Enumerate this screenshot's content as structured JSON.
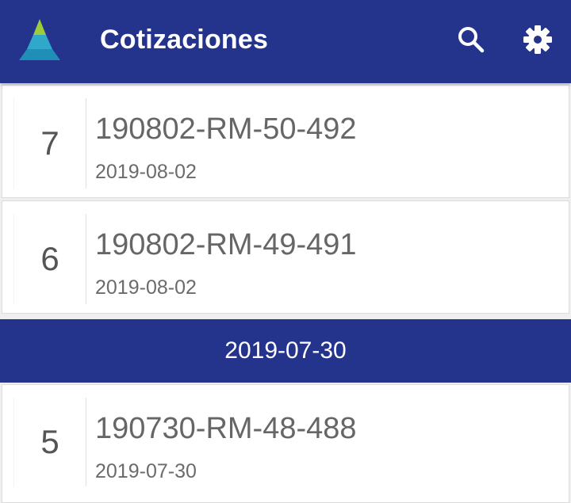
{
  "header": {
    "title": "Cotizaciones",
    "logo_icon": "pyramid-logo-icon",
    "search_icon": "search-icon",
    "settings_icon": "gear-icon",
    "bar_color": "#24338b"
  },
  "quotes_top": [
    {
      "number": "7",
      "code": "190802-RM-50-492",
      "date": "2019-08-02"
    },
    {
      "number": "6",
      "code": "190802-RM-49-491",
      "date": "2019-08-02"
    }
  ],
  "section": {
    "date": "2019-07-30",
    "quotes": [
      {
        "number": "5",
        "code": "190730-RM-48-488",
        "date": "2019-07-30"
      }
    ]
  }
}
